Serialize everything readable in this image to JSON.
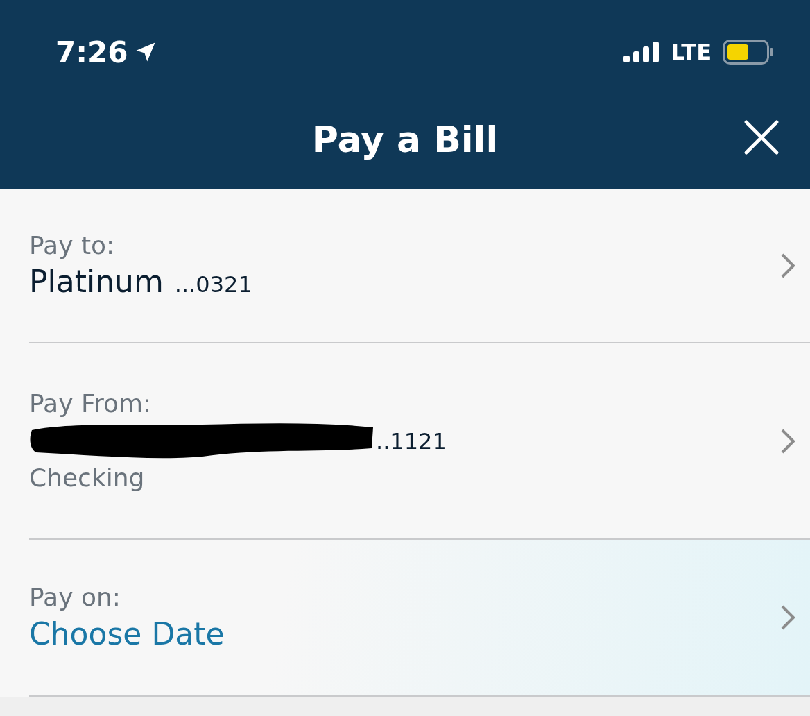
{
  "status_bar": {
    "time": "7:26",
    "network": "LTE"
  },
  "header": {
    "title": "Pay a Bill"
  },
  "fields": [
    {
      "kind": "payee",
      "label": "Pay to:",
      "value": "Platinum",
      "suffix": "...0321",
      "highlighted": false
    },
    {
      "kind": "account",
      "label": "Pay From:",
      "suffix": "..1121",
      "detail": "Checking",
      "highlighted": false
    },
    {
      "kind": "date",
      "label": "Pay on:",
      "value": "Choose Date",
      "highlighted": true
    }
  ]
}
